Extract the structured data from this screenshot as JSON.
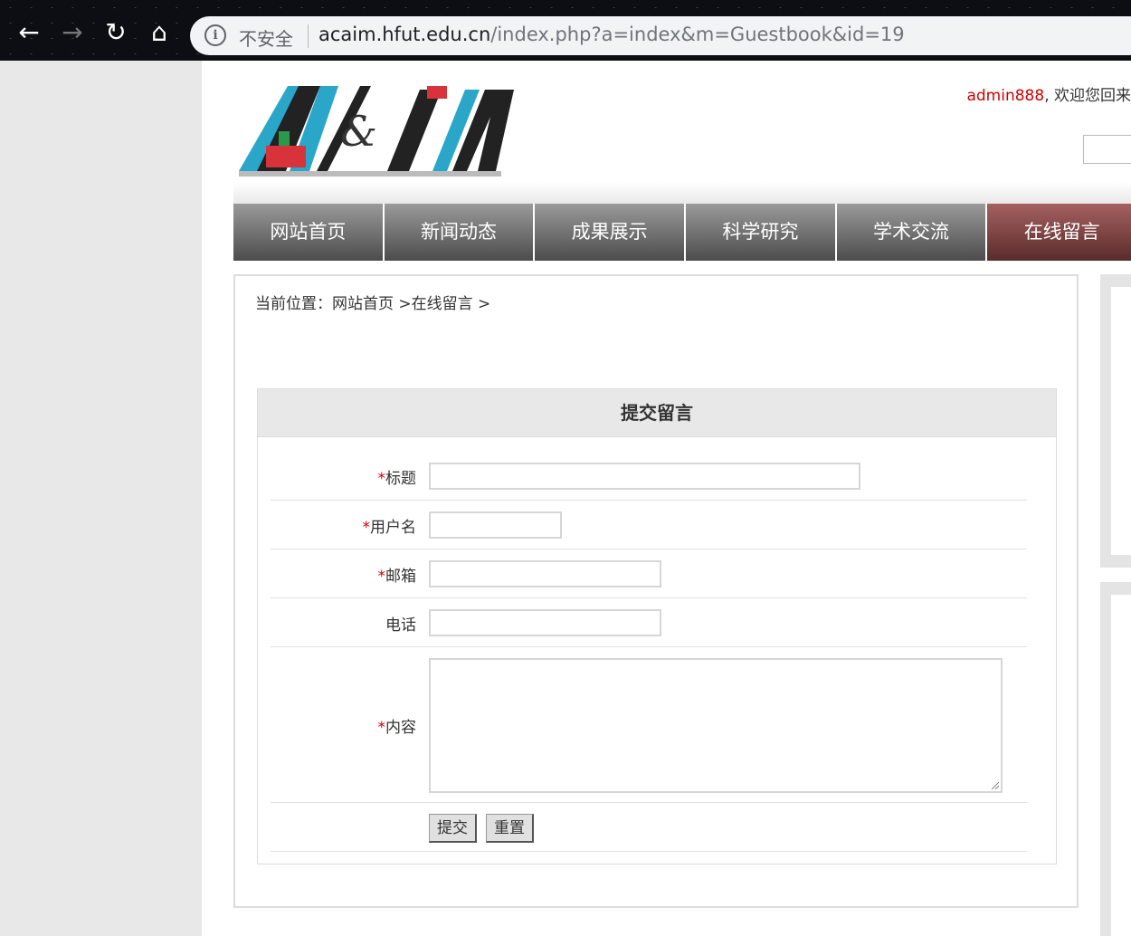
{
  "browser": {
    "insecure_label": "不安全",
    "url_host": "acaim.hfut.edu.cn",
    "url_path": "/index.php?a=index&m=Guestbook&id=19"
  },
  "header": {
    "username": "admin888",
    "welcome_suffix": ", 欢迎您回来"
  },
  "nav": {
    "items": [
      {
        "label": "网站首页"
      },
      {
        "label": "新闻动态"
      },
      {
        "label": "成果展示"
      },
      {
        "label": "科学研究"
      },
      {
        "label": "学术交流"
      },
      {
        "label": "在线留言"
      }
    ],
    "active_index": 5
  },
  "breadcrumb": {
    "text": "当前位置：网站首页 >在线留言 >"
  },
  "form": {
    "title": "提交留言",
    "required_mark": "*",
    "fields": {
      "title_label": "标题",
      "username_label": "用户名",
      "email_label": "邮箱",
      "phone_label": "电话",
      "content_label": "内容"
    },
    "submit_label": "提交",
    "reset_label": "重置"
  },
  "colors": {
    "accent_red": "#d40000",
    "nav_gray": "#666666",
    "nav_active": "#7a3f3f"
  }
}
